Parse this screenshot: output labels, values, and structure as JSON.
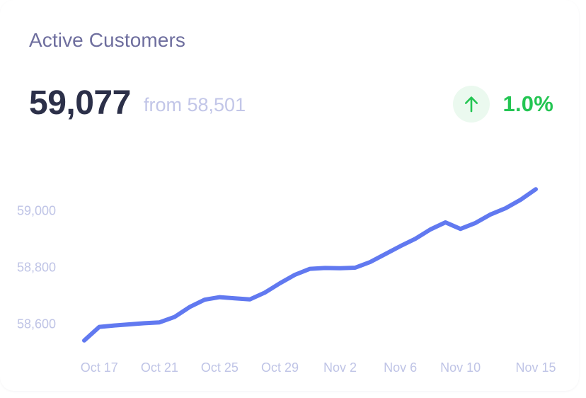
{
  "card": {
    "title": "Active Customers",
    "metric_value": "59,077",
    "previous_label": "from 58,501",
    "delta_percent": "1.0%",
    "delta_direction": "up",
    "delta_icon": "arrow-up-icon",
    "accent_line_color": "#6179F0",
    "positive_color": "#23C552",
    "positive_badge_bg": "#EBF9EF",
    "title_color": "#6E6E9E",
    "value_color": "#2C3049",
    "muted_color": "#BFC4E6"
  },
  "chart_data": {
    "type": "line",
    "title": "Active Customers",
    "xlabel": "",
    "ylabel": "",
    "grid": false,
    "legend": "none",
    "ylim": [
      58540,
      59120
    ],
    "yticks": [
      58600,
      58800,
      59000
    ],
    "ytick_labels": [
      "58,600",
      "58,800",
      "59,000"
    ],
    "xtick_labels": [
      "Oct 17",
      "Oct 21",
      "Oct 25",
      "Oct 29",
      "Nov 2",
      "Nov 6",
      "Nov 10",
      "Nov 15"
    ],
    "x": [
      "Oct 16",
      "Oct 17",
      "Oct 18",
      "Oct 19",
      "Oct 20",
      "Oct 21",
      "Oct 22",
      "Oct 23",
      "Oct 24",
      "Oct 25",
      "Oct 26",
      "Oct 27",
      "Oct 28",
      "Oct 29",
      "Oct 30",
      "Oct 31",
      "Nov 1",
      "Nov 2",
      "Nov 3",
      "Nov 4",
      "Nov 5",
      "Nov 6",
      "Nov 7",
      "Nov 8",
      "Nov 9",
      "Nov 10",
      "Nov 11",
      "Nov 12",
      "Nov 13",
      "Nov 14",
      "Nov 15"
    ],
    "series": [
      {
        "name": "Active Customers",
        "color": "#6179F0",
        "values": [
          58543,
          58591,
          58596,
          58600,
          58604,
          58607,
          58626,
          58661,
          58687,
          58696,
          58692,
          58688,
          58712,
          58745,
          58775,
          58796,
          58799,
          58798,
          58800,
          58820,
          58848,
          58876,
          58902,
          58935,
          58960,
          58937,
          58958,
          58988,
          59010,
          59040,
          59077
        ]
      }
    ]
  }
}
